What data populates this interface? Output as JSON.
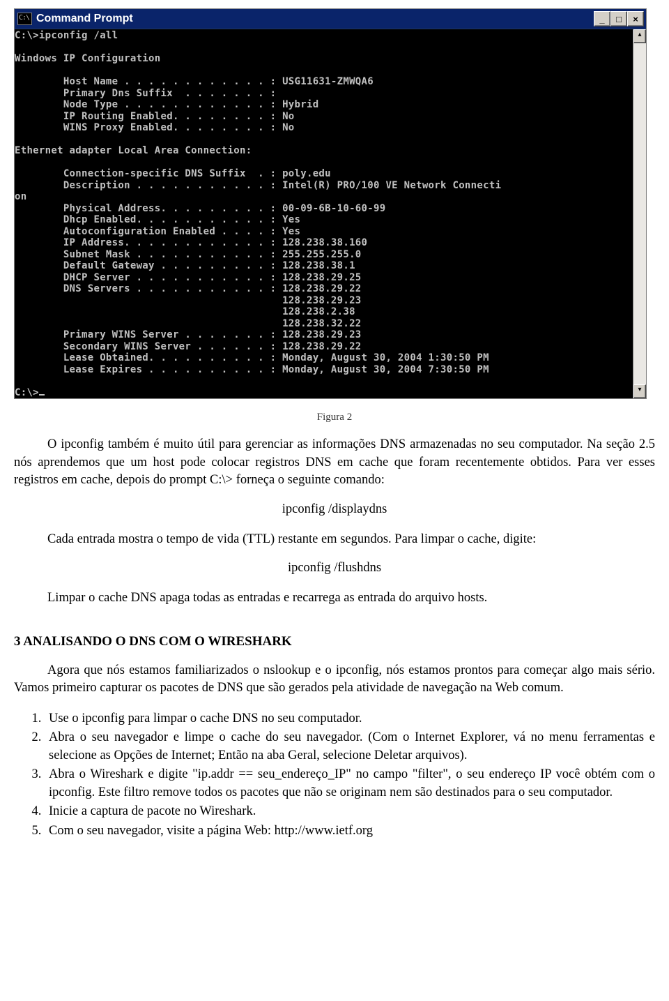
{
  "cmd": {
    "icon_text": "C:\\",
    "title": "Command Prompt",
    "min_glyph": "_",
    "max_glyph": "□",
    "close_glyph": "×",
    "scroll_up": "▴",
    "scroll_down": "▾",
    "line_prompt_cmd": "C:\\>ipconfig /all",
    "blank": "",
    "header": "Windows IP Configuration",
    "host_name": "        Host Name . . . . . . . . . . . . : USG11631-ZMWQA6",
    "dns_suffix": "        Primary Dns Suffix  . . . . . . . :",
    "node_type": "        Node Type . . . . . . . . . . . . : Hybrid",
    "ip_routing": "        IP Routing Enabled. . . . . . . . : No",
    "wins_proxy": "        WINS Proxy Enabled. . . . . . . . : No",
    "adapter_header": "Ethernet adapter Local Area Connection:",
    "conn_suffix": "        Connection-specific DNS Suffix  . : poly.edu",
    "description": "        Description . . . . . . . . . . . : Intel(R) PRO/100 VE Network Connecti",
    "on_wrap": "on",
    "phys_addr": "        Physical Address. . . . . . . . . : 00-09-6B-10-60-99",
    "dhcp_enabled": "        Dhcp Enabled. . . . . . . . . . . : Yes",
    "autoconfig": "        Autoconfiguration Enabled . . . . : Yes",
    "ip_addr": "        IP Address. . . . . . . . . . . . : 128.238.38.160",
    "subnet": "        Subnet Mask . . . . . . . . . . . : 255.255.255.0",
    "gateway": "        Default Gateway . . . . . . . . . : 128.238.38.1",
    "dhcp_server": "        DHCP Server . . . . . . . . . . . : 128.238.29.25",
    "dns_servers": "        DNS Servers . . . . . . . . . . . : 128.238.29.22",
    "dns2": "                                            128.238.29.23",
    "dns3": "                                            128.238.2.38",
    "dns4": "                                            128.238.32.22",
    "wins_primary": "        Primary WINS Server . . . . . . . : 128.238.29.23",
    "wins_secondary": "        Secondary WINS Server . . . . . . : 128.238.29.22",
    "lease_obtained": "        Lease Obtained. . . . . . . . . . : Monday, August 30, 2004 1:30:50 PM",
    "lease_expires": "        Lease Expires . . . . . . . . . . : Monday, August 30, 2004 7:30:50 PM",
    "final_prompt": "C:\\>"
  },
  "caption": "Figura 2",
  "para1": "O ipconfig também é muito útil para gerenciar as informações DNS armazenadas no seu computador. Na seção 2.5 nós aprendemos que um host pode colocar registros DNS em cache que foram recentemente obtidos. Para ver esses registros em cache, depois do prompt C:\\> forneça o seguinte comando:",
  "cmd1": "ipconfig /displaydns",
  "para2": "Cada entrada mostra o tempo de vida (TTL) restante em segundos. Para limpar o cache, digite:",
  "cmd2": "ipconfig /flushdns",
  "para3": "Limpar o cache DNS apaga todas as entradas e recarrega as entrada do arquivo hosts.",
  "section_heading": "3 ANALISANDO O DNS COM O WIRESHARK",
  "para4": "Agora que nós estamos familiarizados o nslookup e o ipconfig, nós estamos prontos para começar algo mais sério. Vamos primeiro capturar os pacotes de DNS que são gerados pela atividade de navegação na Web comum.",
  "steps": {
    "s1": "Use o ipconfig para limpar o cache DNS no seu computador.",
    "s2": "Abra o seu navegador e limpe o cache do seu navegador. (Com o Internet Explorer, vá no menu ferramentas e selecione as Opções de Internet; Então na aba Geral, selecione Deletar arquivos).",
    "s3": "Abra o Wireshark e digite \"ip.addr == seu_endereço_IP\" no campo \"filter\", o seu endereço IP você obtém com o ipconfig. Este filtro remove todos os pacotes que não se originam nem são destinados para o seu computador.",
    "s4": "Inicie a captura de pacote no Wireshark.",
    "s5": "Com o seu navegador, visite a página Web: http://www.ietf.org"
  }
}
